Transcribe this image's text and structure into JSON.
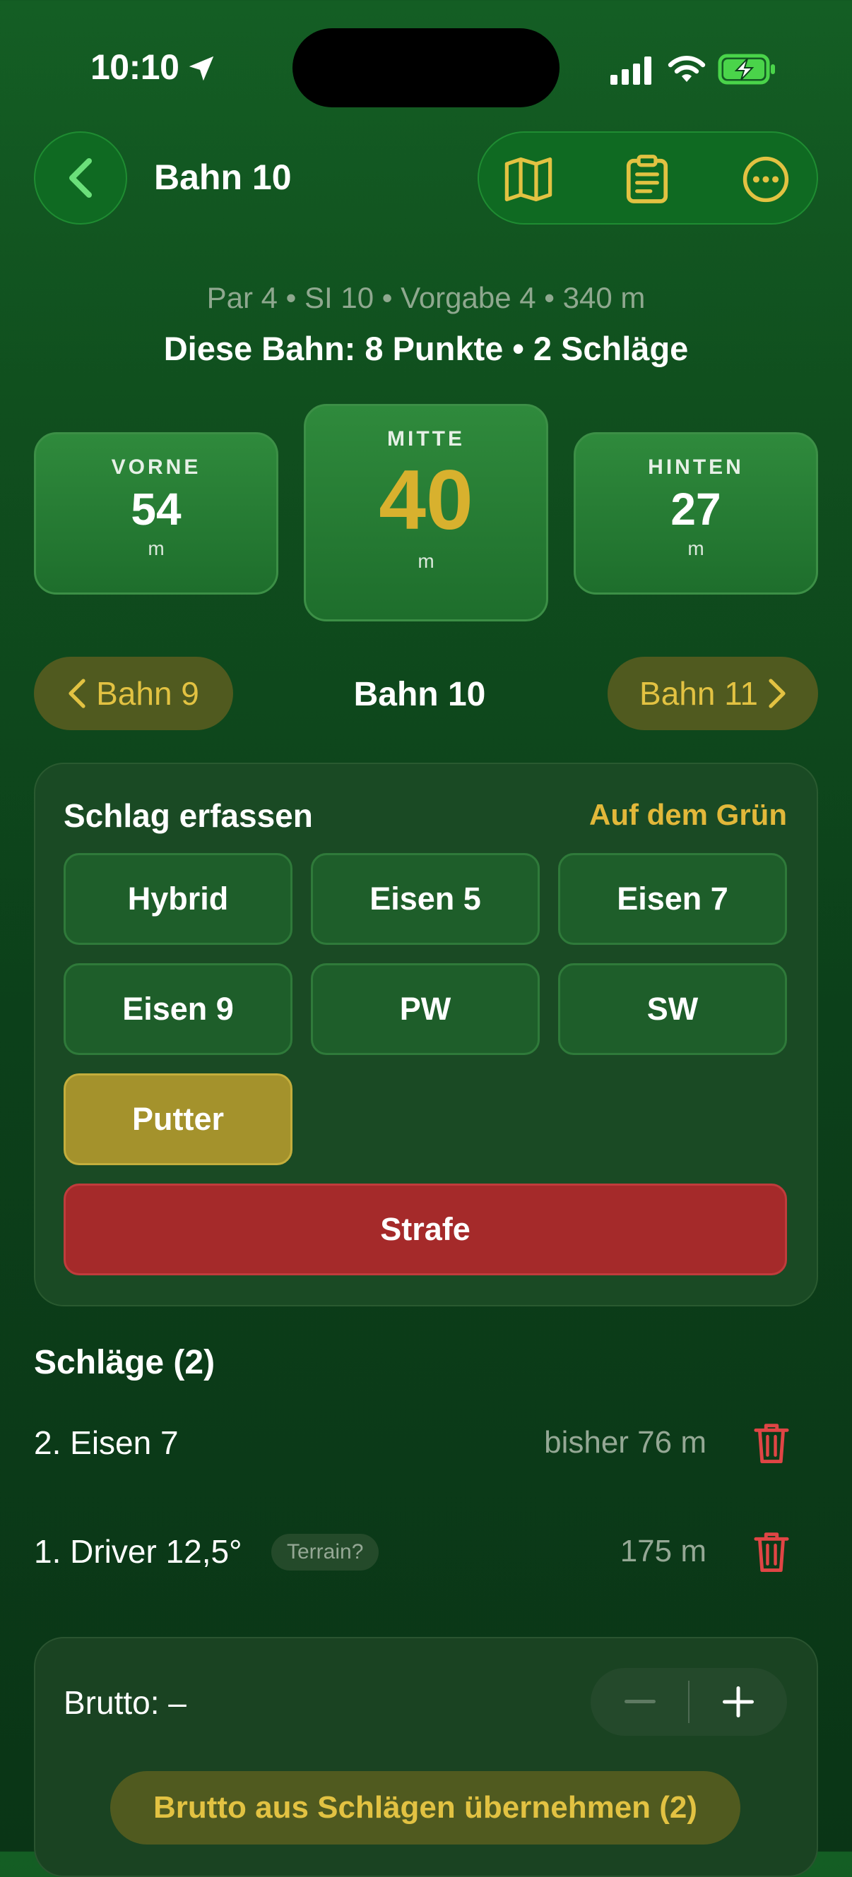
{
  "status_bar": {
    "time": "10:10",
    "icons": [
      "location-arrow-icon",
      "cellular-signal-icon",
      "wifi-icon",
      "battery-charging-icon"
    ]
  },
  "nav": {
    "title": "Bahn 10",
    "icons": [
      "back-chevron-icon",
      "map-icon",
      "clipboard-icon",
      "more-icon"
    ]
  },
  "hole_info": {
    "subtitle": "Par 4 • SI 10 • Vorgabe 4 • 340 m",
    "summary": "Diese Bahn: 8 Punkte • 2 Schläge"
  },
  "distances": {
    "front": {
      "label": "VORNE",
      "value": "54",
      "unit": "m"
    },
    "middle": {
      "label": "MITTE",
      "value": "40",
      "unit": "m"
    },
    "back": {
      "label": "HINTEN",
      "value": "27",
      "unit": "m"
    }
  },
  "hole_nav": {
    "prev": "Bahn 9",
    "current": "Bahn 10",
    "next": "Bahn 11"
  },
  "shot_entry": {
    "title": "Schlag erfassen",
    "on_green": "Auf dem Grün",
    "clubs": [
      "Hybrid",
      "Eisen 5",
      "Eisen 7",
      "Eisen 9",
      "PW",
      "SW",
      "Putter"
    ],
    "selected_club": "Putter",
    "penalty": "Strafe"
  },
  "shots": {
    "title": "Schläge (2)",
    "items": [
      {
        "name": "2. Eisen 7",
        "distance": "bisher 76 m"
      },
      {
        "name": "1. Driver 12,5°",
        "badge": "Terrain?",
        "distance": "175 m"
      }
    ]
  },
  "brutto": {
    "label": "Brutto: –",
    "apply": "Brutto aus Schlägen übernehmen (2)"
  },
  "colors": {
    "accent_gold": "#e2c242",
    "selected_club": "#a4922c",
    "penalty_red": "#a52a2a",
    "trash_red": "#e04545",
    "background_green": "#104f1e"
  }
}
